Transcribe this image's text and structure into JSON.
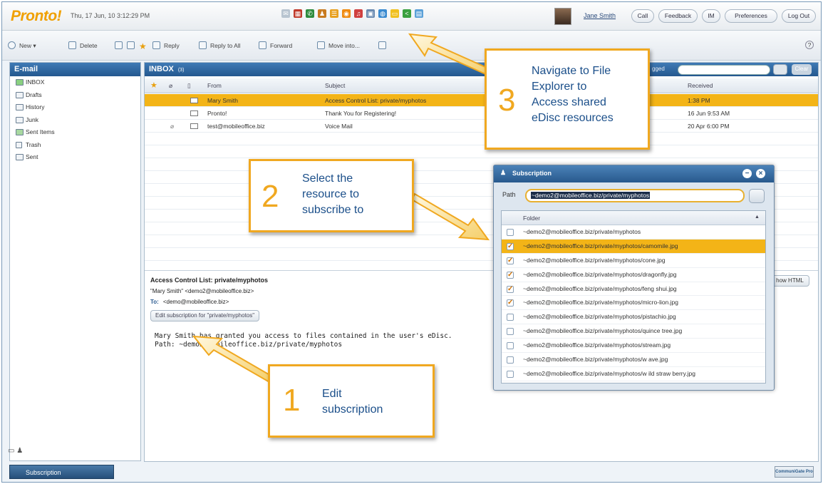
{
  "header": {
    "logo": "Pronto!",
    "datetime": "Thu, 17 Jun, 10 3:12:29 PM",
    "user": "Jane Smith",
    "buttons": [
      "Call",
      "Feedback",
      "IM",
      "Preferences",
      "Log Out"
    ]
  },
  "toolbar": {
    "new": "New",
    "delete": "Delete",
    "reply": "Reply",
    "reply_all": "Reply to All",
    "forward": "Forward",
    "move": "Move into...",
    "help": "?"
  },
  "left": {
    "title": "E-mail",
    "folders": [
      "INBOX",
      "Drafts",
      "History",
      "Junk",
      "Sent Items",
      "Trash",
      "Sent"
    ],
    "subscription_tab": "Subscription"
  },
  "inbox": {
    "title": "INBOX",
    "count": "(3)",
    "flagged": "gged",
    "clear": "Clear",
    "columns": {
      "from": "From",
      "subject": "Subject",
      "received": "Received"
    },
    "rows": [
      {
        "from": "Mary Smith",
        "subject": "Access Control List: private/myphotos",
        "received": "1:38 PM"
      },
      {
        "from": "Pronto!",
        "subject": "Thank You for Registering!",
        "received": "16 Jun 9:53 AM"
      },
      {
        "from": "test@mobileoffice.biz",
        "subject": "Voice Mail",
        "received": "20 Apr 6:00 PM"
      }
    ]
  },
  "preview": {
    "title": "Access Control List: private/myphotos",
    "from": "\"Mary Smith\" <demo2@mobileoffice.biz>",
    "to_label": "To:",
    "to": "<demo@mobileoffice.biz>",
    "edit_button": "Edit subscription for \"private/myphotos\"",
    "body": "Mary Smith has granted you access to files contained in the user's eDisc.\nPath: ~demo2@mobileoffice.biz/private/myphotos",
    "show_html": "how HTML"
  },
  "dialog": {
    "title": "Subscription",
    "path_label": "Path",
    "path_value": "~demo2@mobileoffice.biz/private/myphotos",
    "column": "Folder",
    "items": [
      {
        "name": "~demo2@mobileoffice.biz/private/myphotos",
        "checked": false
      },
      {
        "name": "~demo2@mobileoffice.biz/private/myphotos/camomile.jpg",
        "checked": true
      },
      {
        "name": "~demo2@mobileoffice.biz/private/myphotos/cone.jpg",
        "checked": true
      },
      {
        "name": "~demo2@mobileoffice.biz/private/myphotos/dragonfly.jpg",
        "checked": true
      },
      {
        "name": "~demo2@mobileoffice.biz/private/myphotos/feng shui.jpg",
        "checked": true
      },
      {
        "name": "~demo2@mobileoffice.biz/private/myphotos/micro-lion.jpg",
        "checked": true
      },
      {
        "name": "~demo2@mobileoffice.biz/private/myphotos/pistachio.jpg",
        "checked": false
      },
      {
        "name": "~demo2@mobileoffice.biz/private/myphotos/quince tree.jpg",
        "checked": false
      },
      {
        "name": "~demo2@mobileoffice.biz/private/myphotos/stream.jpg",
        "checked": false
      },
      {
        "name": "~demo2@mobileoffice.biz/private/myphotos/w ave.jpg",
        "checked": false
      },
      {
        "name": "~demo2@mobileoffice.biz/private/myphotos/w ild straw berry.jpg",
        "checked": false
      }
    ]
  },
  "callouts": {
    "c1": {
      "num": "1",
      "text": "Edit\nsubscription"
    },
    "c2": {
      "num": "2",
      "text": "Select the\nresource to\nsubscribe to"
    },
    "c3": {
      "num": "3",
      "text": "Navigate to File\nExplorer to\nAccess shared\neDisc resources"
    }
  },
  "footer": {
    "badge": "CommuniGate Pro"
  },
  "colors": {
    "accent": "#f3b417",
    "header": "#24588f",
    "callout": "#f0a820",
    "callout_text": "#1b4f8a"
  }
}
